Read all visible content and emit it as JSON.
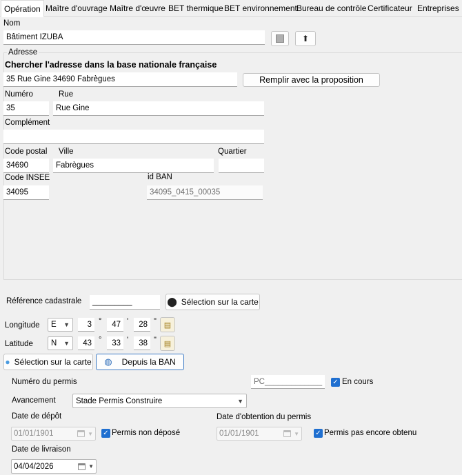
{
  "tabs": [
    "Opération",
    "Maître d'ouvrage",
    "Maître d'œuvre",
    "BET thermique",
    "BET environnement",
    "Bureau de contrôle",
    "Certificateur",
    "Entreprises"
  ],
  "nom": {
    "label": "Nom",
    "value": "Bâtiment IZUBA"
  },
  "adresse": {
    "group_title": "Adresse",
    "search_title": "Chercher l'adresse dans la base nationale française",
    "search_value": "35 Rue Gine 34690 Fabrègues",
    "fill_button": "Remplir avec la proposition",
    "numero": {
      "label": "Numéro",
      "value": "35"
    },
    "rue": {
      "label": "Rue",
      "value": "Rue Gine"
    },
    "complement": {
      "label": "Complément",
      "value": ""
    },
    "code_postal": {
      "label": "Code postal",
      "value": "34690"
    },
    "ville": {
      "label": "Ville",
      "value": "Fabrègues"
    },
    "quartier": {
      "label": "Quartier",
      "value": ""
    },
    "code_insee": {
      "label": "Code INSEE",
      "value": "34095"
    },
    "id_ban": {
      "label": "id BAN",
      "value": "34095_0415_00035"
    }
  },
  "cadastre": {
    "label": "Référence cadastrale",
    "value": "_________",
    "map_button": "Sélection sur la carte"
  },
  "longitude": {
    "label": "Longitude",
    "dir": "E",
    "deg": "3",
    "min": "47",
    "sec": "28"
  },
  "latitude": {
    "label": "Latitude",
    "dir": "N",
    "deg": "43",
    "min": "33",
    "sec": "38"
  },
  "symbols": {
    "deg": "°",
    "min": "'",
    "sec": "\""
  },
  "geo_buttons": {
    "map": "Sélection sur la carte",
    "ban": "Depuis la BAN"
  },
  "permis": {
    "numero_label": "Numéro du permis",
    "numero_value": "PC_____________",
    "en_cours_label": "En cours",
    "avancement_label": "Avancement",
    "avancement_value": "Stade Permis Construire",
    "depot_label": "Date de dépôt",
    "depot_value": "01/01/1901",
    "non_depose_label": "Permis non déposé",
    "obtention_label": "Date d'obtention du permis",
    "obtention_value": "01/01/1901",
    "pas_obtenu_label": "Permis pas encore obtenu",
    "livraison_label": "Date de livraison",
    "livraison_value": "04/04/2026"
  },
  "colors": {
    "accent": "#1f6fd0",
    "background": "#f0f0f0"
  }
}
